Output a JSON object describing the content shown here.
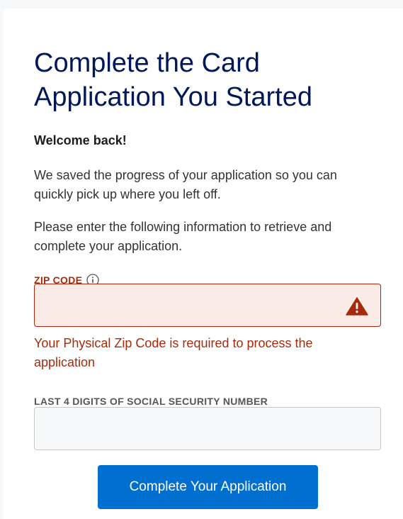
{
  "heading": "Complete the Card Application You Started",
  "welcome": "Welcome back!",
  "paragraphs": [
    "We saved the progress of your application so you can quickly pick up where you left off.",
    "Please enter the following information to retrieve and complete your application."
  ],
  "zip": {
    "label": "ZIP CODE",
    "value": "",
    "error": "Your Physical Zip Code is required to process the application",
    "info_icon": "info-icon",
    "warning_icon": "warning-icon"
  },
  "ssn": {
    "label": "LAST 4 DIGITS OF SOCIAL SECURITY NUMBER",
    "value": ""
  },
  "submit_label": "Complete Your Application",
  "colors": {
    "heading": "#00175a",
    "error": "#a62b0d",
    "error_bg": "#fbebe7",
    "button": "#006fcf"
  }
}
